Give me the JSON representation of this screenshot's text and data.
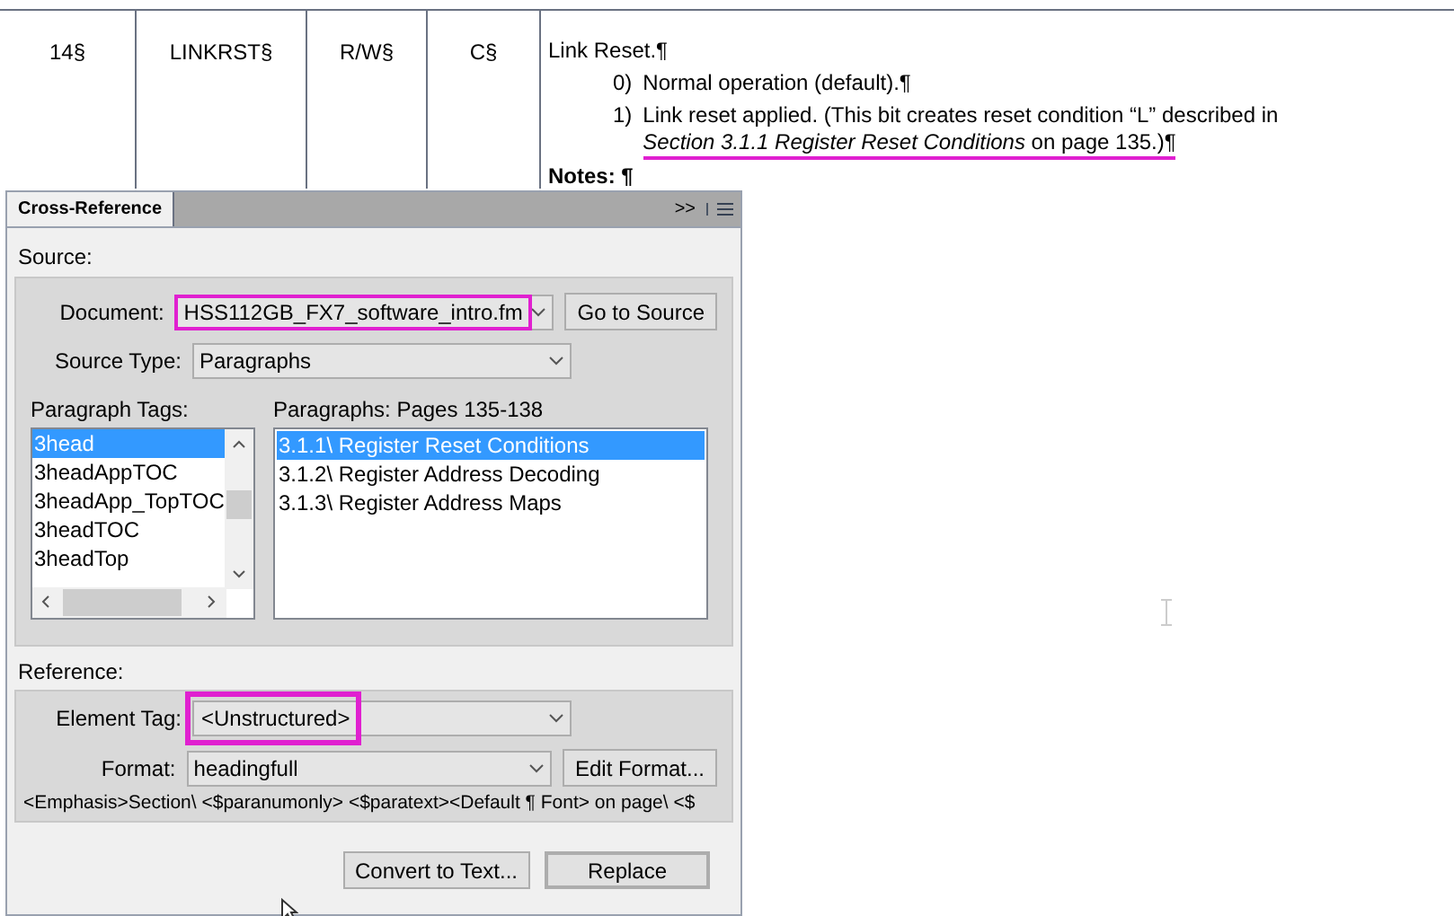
{
  "table_row": {
    "cells": [
      "14§",
      "LINKRST§",
      "R/W§",
      "C§"
    ],
    "description": {
      "title": "Link Reset.¶",
      "items": [
        {
          "number": "0)",
          "lines": [
            "Normal operation (default).¶"
          ]
        },
        {
          "number": "1)",
          "lines": [
            "Link reset applied. (This bit creates reset condition “L” described in",
            "*Section 3.1.1 Register Reset Conditions* on page 135.)¶"
          ]
        }
      ],
      "notes": "Notes:  ¶"
    }
  },
  "dialog": {
    "tab": "Cross-Reference",
    "overflow": ">>",
    "source_label": "Source:",
    "document": {
      "label": "Document:",
      "value": "HSS112GB_FX7_software_intro.fm"
    },
    "go_to_source": "Go to Source",
    "source_type": {
      "label": "Source Type:",
      "value": "Paragraphs"
    },
    "paragraph_tags": {
      "label": "Paragraph Tags:",
      "items": [
        {
          "text": "3head",
          "selected": true
        },
        {
          "text": "3headAppTOC",
          "selected": false
        },
        {
          "text": "3headApp_TopTOC",
          "selected": false
        },
        {
          "text": "3headTOC",
          "selected": false
        },
        {
          "text": "3headTop",
          "selected": false
        }
      ]
    },
    "paragraphs": {
      "label": "Paragraphs: Pages  135-138",
      "items": [
        {
          "text": "3.1.1\\  Register Reset Conditions",
          "selected": true
        },
        {
          "text": "3.1.2\\  Register Address Decoding",
          "selected": false
        },
        {
          "text": "3.1.3\\  Register Address Maps",
          "selected": false
        }
      ]
    },
    "reference_label": "Reference:",
    "element_tag": {
      "label": "Element Tag:",
      "value": "<Unstructured>"
    },
    "format": {
      "label": "Format:",
      "value": "headingfull"
    },
    "edit_format": "Edit Format...",
    "format_definition": "<Emphasis>Section\\ <$paranumonly> <$paratext><Default ¶ Font> on page\\ <$",
    "buttons": [
      {
        "label": "Convert to Text...",
        "default": false
      },
      {
        "label": "Replace",
        "default": true
      }
    ]
  }
}
